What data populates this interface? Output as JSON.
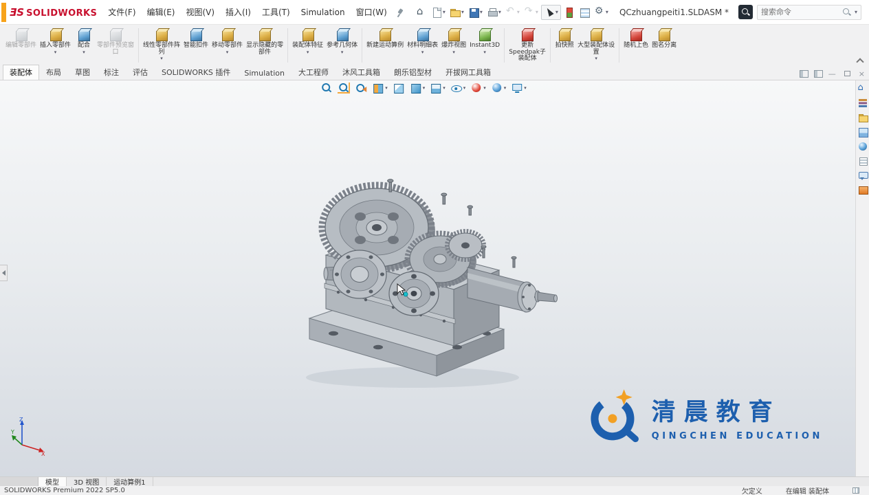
{
  "titlebar": {
    "brand_mark": "ƎS",
    "brand": "SOLIDWORKS",
    "menus": [
      "文件(F)",
      "编辑(E)",
      "视图(V)",
      "插入(I)",
      "工具(T)",
      "Simulation",
      "窗口(W)"
    ],
    "quick_access_icons": [
      "home-icon",
      "new-document-icon",
      "open-icon",
      "save-icon",
      "print-icon",
      "undo-icon",
      "redo-icon",
      "select-cursor-icon",
      "rebuild-icon",
      "selection-filter-icon",
      "options-gear-icon"
    ],
    "document_title": "QCzhuangpeiti1.SLDASM *",
    "search_placeholder": "搜索命令",
    "right_icons": [
      "user-account-icon",
      "help-icon",
      "minimize-icon",
      "maximize-icon",
      "close-icon"
    ]
  },
  "ribbon": {
    "buttons": [
      {
        "label": "编辑零部件"
      },
      {
        "label": "插入零部件"
      },
      {
        "label": "配合"
      },
      {
        "label": "零部件预览窗口"
      },
      {
        "label": "线性零部件阵列"
      },
      {
        "label": "智能扣件"
      },
      {
        "label": "移动零部件"
      },
      {
        "label": "显示隐藏的零部件"
      },
      {
        "label": "装配体特征"
      },
      {
        "label": "参考几何体"
      },
      {
        "label": "新建运动算例"
      },
      {
        "label": "材料明细表"
      },
      {
        "label": "爆炸视图"
      },
      {
        "label": "Instant3D"
      },
      {
        "label": "更新Speedpak子装配体"
      },
      {
        "label": "拍快照"
      },
      {
        "label": "大型装配体设置"
      },
      {
        "label": "随机上色"
      },
      {
        "label": "图名分离"
      }
    ]
  },
  "tabs": {
    "items": [
      "装配体",
      "布局",
      "草图",
      "标注",
      "评估",
      "SOLIDWORKS 插件",
      "Simulation",
      "大工程师",
      "沐风工具箱",
      "朗乐铝型材",
      "开拔网工具箱"
    ],
    "active": "装配体"
  },
  "hud_icons": [
    "zoom-fit-icon",
    "zoom-area-icon",
    "previous-view-icon",
    "section-view-icon",
    "annotation-views-icon",
    "view-orientation-icon",
    "display-style-icon",
    "hide-show-items-icon",
    "edit-appearance-icon",
    "apply-scene-icon",
    "view-settings-icon"
  ],
  "taskpane_icons": [
    "solidworks-resources-icon",
    "design-library-icon",
    "file-explorer-icon",
    "view-palette-icon",
    "appearances-scenes-icon",
    "custom-properties-icon",
    "solidworks-forum-icon",
    "xpress-products-icon"
  ],
  "watermark": {
    "cn": "清晨教育",
    "en": "QINGCHEN EDUCATION"
  },
  "triad": {
    "x": "X",
    "y": "Y",
    "z": "Z"
  },
  "bottom_tabs": [
    "模型",
    "3D 视图",
    "运动算例1"
  ],
  "status": {
    "product": "SOLIDWORKS Premium 2022 SP5.0",
    "definition": "欠定义",
    "editing": "在编辑 装配体"
  }
}
